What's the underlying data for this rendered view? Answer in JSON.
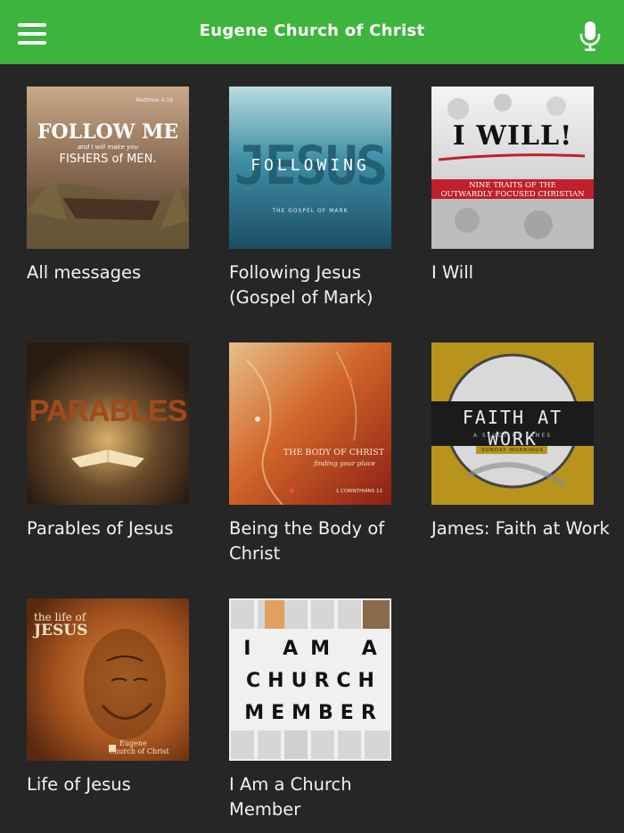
{
  "header": {
    "title": "Eugene Church of Christ",
    "menu_icon": "hamburger-menu-icon",
    "mic_icon": "microphone-icon",
    "accent": "#3db53d"
  },
  "series": [
    {
      "label": "All messages",
      "art": {
        "line1": "FOLLOW ME",
        "line2": "and I will make you",
        "line3": "FISHERS of MEN.",
        "ref": "Matthew 4:19"
      }
    },
    {
      "label": "Following Jesus (Gospel of Mark)",
      "art": {
        "big": "JESUS",
        "overlay": "FOLLOWING",
        "sub": "THE GOSPEL OF MARK"
      }
    },
    {
      "label": "I Will",
      "art": {
        "big": "I WILL!",
        "sub1": "NINE TRAITS OF THE",
        "sub2": "OUTWARDLY FOCUSED CHRISTIAN"
      }
    },
    {
      "label": "Parables of Jesus",
      "art": {
        "big": "PARABLES"
      }
    },
    {
      "label": "Being the Body of Christ",
      "art": {
        "line1": "THE BODY OF CHRIST",
        "line2": "finding your place",
        "ref": "1 CORINTHIANS 12"
      }
    },
    {
      "label": "James: Faith at Work",
      "art": {
        "big": "FAITH AT WORK",
        "sub": "A STUDY OF JAMES",
        "band": "SUNDAY MORNINGS"
      }
    },
    {
      "label": "Life of Jesus",
      "art": {
        "line1": "the life of",
        "line2": "JESUS",
        "brand1": "Eugene",
        "brand2": "Church of Christ"
      }
    },
    {
      "label": "I Am a Church Member",
      "art": {
        "row1": "I AM A",
        "row2": "CHURCH",
        "row3": "MEMBER"
      }
    }
  ]
}
